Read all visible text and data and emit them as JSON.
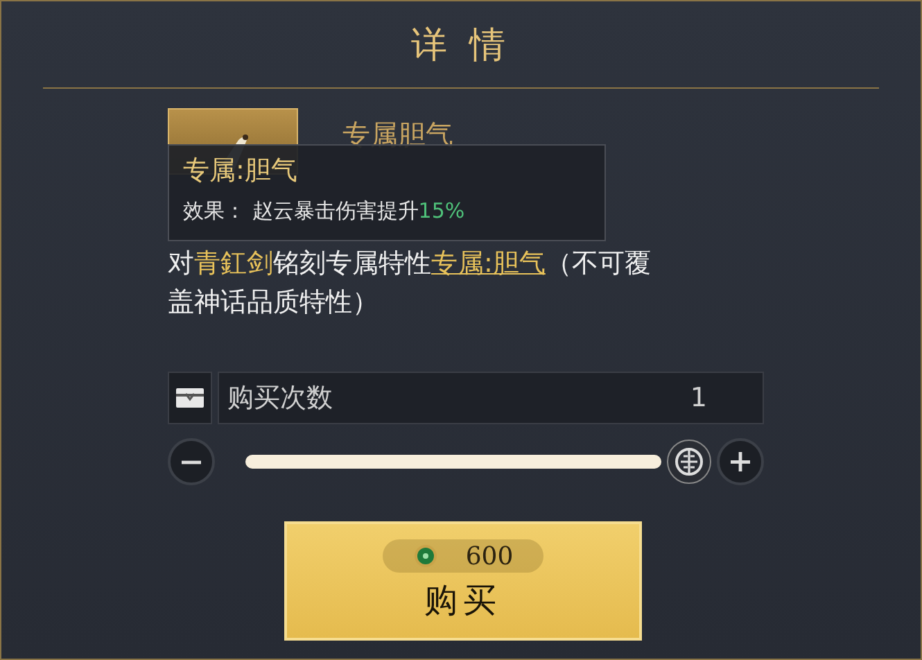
{
  "window": {
    "title": "详 情"
  },
  "item": {
    "name": "专属胆气"
  },
  "tooltip": {
    "title": "专属:胆气",
    "effect_label": "效果：",
    "effect_text": "赵云暴击伤害提升",
    "effect_value": "15%"
  },
  "description": [
    {
      "kind": "plain",
      "text": "对"
    },
    {
      "kind": "weapon",
      "text": "青釭剑"
    },
    {
      "kind": "plain",
      "text": "铭刻专属特性"
    },
    {
      "kind": "trait",
      "text": "专属:胆气"
    },
    {
      "kind": "plain",
      "text": "（不可覆盖神话品质特性）"
    }
  ],
  "quantity": {
    "label": "购买次数",
    "value": "1"
  },
  "slider": {
    "level": 1
  },
  "buy_button": {
    "price": "600",
    "label": "购买"
  }
}
